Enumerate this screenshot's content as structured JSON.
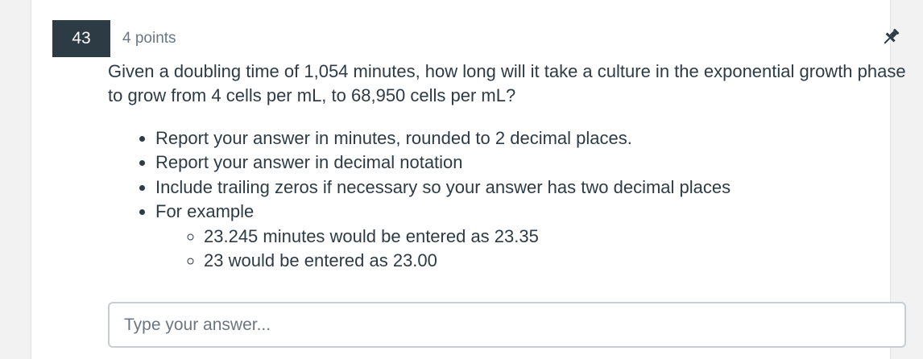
{
  "question": {
    "number": "43",
    "points": "4 points",
    "text": "Given a doubling time of 1,054 minutes, how long will it take a culture in the exponential growth phase to grow from 4 cells per mL, to 68,950 cells per mL?",
    "instructions": [
      "Report your answer in minutes, rounded to 2 decimal places.",
      "Report your answer in decimal notation",
      "Include trailing zeros if necessary so your answer has two decimal places",
      "For example"
    ],
    "examples": [
      "23.245 minutes would be entered as 23.35",
      "23 would be entered as 23.00"
    ]
  },
  "answer": {
    "placeholder": "Type your answer...",
    "value": ""
  },
  "icons": {
    "pin": "pin-icon"
  },
  "colors": {
    "badge_bg": "#2d3b45",
    "text": "#2d3b45",
    "muted": "#6b7780",
    "input_border": "#c7cdd1"
  }
}
